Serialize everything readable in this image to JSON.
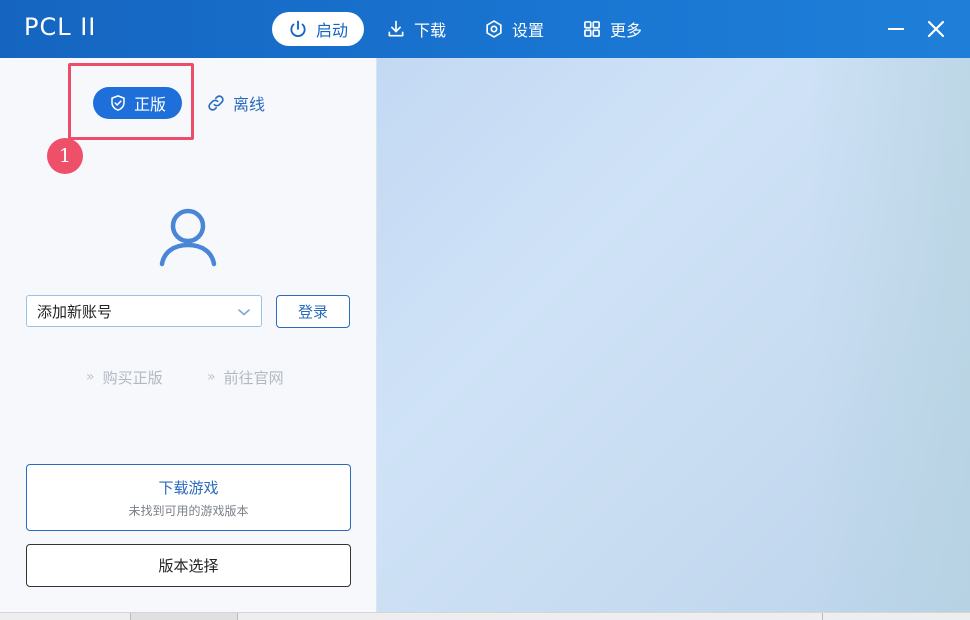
{
  "app": {
    "title": "PCL II"
  },
  "nav": {
    "items": [
      {
        "label": "启动",
        "icon": "power-icon",
        "active": true
      },
      {
        "label": "下载",
        "icon": "download-icon",
        "active": false
      },
      {
        "label": "设置",
        "icon": "gear-icon",
        "active": false
      },
      {
        "label": "更多",
        "icon": "grid-icon",
        "active": false
      }
    ]
  },
  "window_controls": {
    "minimize_icon": "minimize-icon",
    "close_icon": "close-icon"
  },
  "login": {
    "mode_official": "正版",
    "mode_offline": "离线",
    "step_marker": "1",
    "account_select_value": "添加新账号",
    "login_button": "登录",
    "link_buy": "购买正版",
    "link_website": "前往官网",
    "link_prefix": "»"
  },
  "launch": {
    "download_game_title": "下载游戏",
    "download_game_subtitle": "未找到可用的游戏版本",
    "version_select": "版本选择"
  },
  "colors": {
    "titlebar": "#1565c0",
    "accent": "#1e6fd9",
    "highlight": "#ec4d6a"
  }
}
